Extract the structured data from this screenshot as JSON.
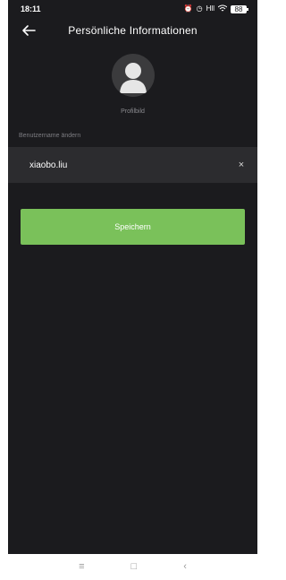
{
  "status_bar": {
    "time": "18:11",
    "alarm_icon": "alarm-icon",
    "clock_icon": "clock-icon",
    "signal_text": "Hll",
    "wifi_icon": "wifi-icon",
    "battery_text": "88"
  },
  "header": {
    "back_icon": "arrow-left-icon",
    "title": "Persönliche Informationen"
  },
  "profile": {
    "avatar_icon": "user-avatar-icon",
    "label": "Profilbild"
  },
  "form": {
    "username_label": "Benutzername ändern",
    "username_value": "xiaobo.liu",
    "clear_symbol": "×"
  },
  "actions": {
    "save_label": "Speichern"
  },
  "nav_bar": {
    "menu_symbol": "≡",
    "home_symbol": "□",
    "back_symbol": "‹"
  },
  "colors": {
    "background": "#1b1b1e",
    "input_background": "#2c2c2f",
    "accent": "#7ac15a"
  }
}
